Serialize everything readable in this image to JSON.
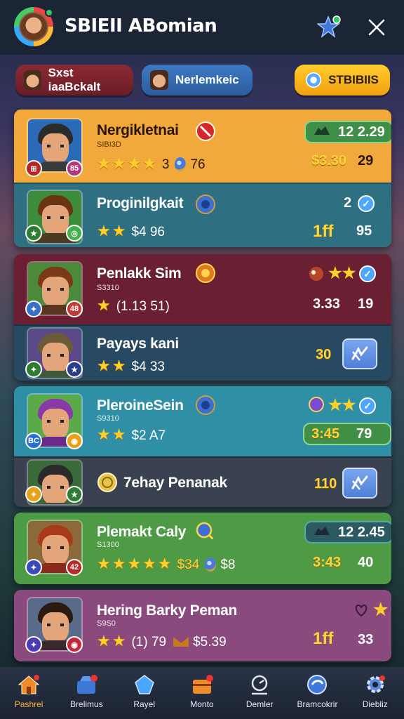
{
  "app": {
    "title": "SBIEII ABomian"
  },
  "header": {
    "star_icon": "star-badge-icon",
    "close_icon": "close-icon"
  },
  "filters": [
    {
      "label": "Sxst iaaBckalt"
    },
    {
      "label": "Nerlemkeic"
    },
    {
      "label": "STBIBIIS"
    }
  ],
  "groups": [
    {
      "color": "#f2a93b",
      "rows": [
        {
          "name": "Nergikletnai",
          "sub": "SIBI3D",
          "stars": "★★★★",
          "stat": "3",
          "extra": "76",
          "badge_l": "⊞",
          "badge_r": "85",
          "right_pill": "12 2.29",
          "price": "$3.30",
          "count": "29",
          "bg": "#f2a93b"
        },
        {
          "name": "Proginilgkait",
          "sub": "",
          "stars": "★★",
          "stat": "$4 96",
          "right_top": "2",
          "right_gold": "1ff",
          "count": "95",
          "bg": "#2f6f82"
        }
      ]
    },
    {
      "color": "#6a1f33",
      "rows": [
        {
          "name": "Penlakk Sim",
          "sub": "S3310",
          "stars": "★",
          "stat": "(1.13 51)",
          "badge_r": "48",
          "right_stars": "★★",
          "price": "3.33",
          "count": "19",
          "bg": "#6a1f33"
        },
        {
          "name": "Payays kani",
          "sub": "",
          "stars": "★★",
          "stat": "$4 33",
          "price": "30",
          "bg": "#274a62"
        }
      ]
    },
    {
      "color": "#2f8fa6",
      "rows": [
        {
          "name": "PleroineSein",
          "sub": "S9310",
          "stars": "★★",
          "stat": "$2 A7",
          "badge_l": "BC",
          "right_stars": "★★",
          "price": "3:45",
          "count": "79",
          "bg": "#2f8fa6"
        },
        {
          "name": "7ehay Penanak",
          "sub": "",
          "right_gold": "110",
          "bg": "#3a4150"
        }
      ]
    },
    {
      "color": "#4f9a44",
      "rows": [
        {
          "name": "Plemakt Caly",
          "sub": "S1300",
          "stars": "★★★★★",
          "stat": "$34",
          "extra": "$8",
          "badge_r": "42",
          "right_pill": "12 2.45",
          "price": "3:43",
          "count": "40",
          "bg": "#4f9a44"
        }
      ]
    },
    {
      "color": "#8a4a7e",
      "rows": [
        {
          "name": "Hering Barky Peman",
          "sub": "S9S0",
          "stars": "★★",
          "stat": "(1) 79",
          "extra": "$5.39",
          "right_gold": "1ff",
          "count": "33",
          "bg": "#8a4a7e"
        }
      ]
    }
  ],
  "nav": [
    {
      "label": "Pashrel",
      "icon": "home-icon"
    },
    {
      "label": "Brelimus",
      "icon": "shop-icon"
    },
    {
      "label": "Rayel",
      "icon": "crystal-icon"
    },
    {
      "label": "Monto",
      "icon": "chest-icon"
    },
    {
      "label": "Demler",
      "icon": "profile-icon"
    },
    {
      "label": "Bramcokrir",
      "icon": "guild-icon"
    },
    {
      "label": "Diebliz",
      "icon": "settings-icon"
    }
  ]
}
